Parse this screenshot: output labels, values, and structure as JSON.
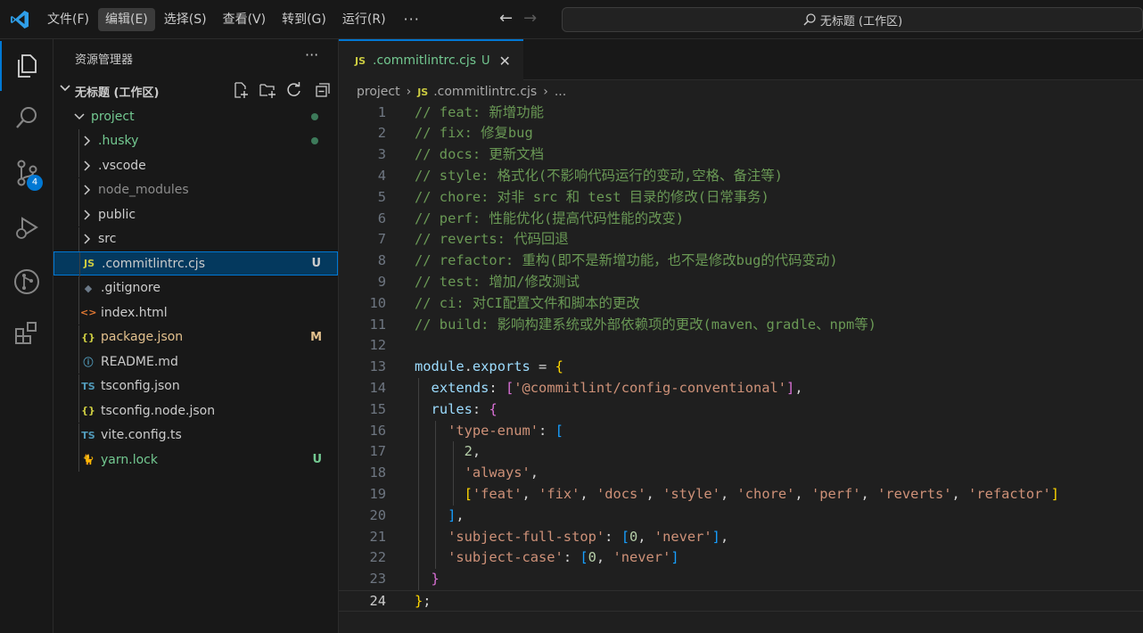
{
  "titlebar": {
    "menu": [
      "文件(F)",
      "编辑(E)",
      "选择(S)",
      "查看(V)",
      "转到(G)",
      "运行(R)",
      "···"
    ],
    "active_menu_index": 1,
    "search_text": "无标题 (工作区)"
  },
  "activity": {
    "items": [
      "explorer-icon",
      "search-icon",
      "source-control-icon",
      "run-debug-icon",
      "git-graph-icon",
      "extensions-icon"
    ],
    "scm_badge": "4"
  },
  "sidebar": {
    "header": "资源管理器",
    "more": "···",
    "workspace_title": "无标题 (工作区)",
    "items": [
      {
        "label": "project",
        "type": "folder-open",
        "color": "#73c991",
        "status": "dot"
      },
      {
        "label": ".husky",
        "type": "folder",
        "color": "#73c991",
        "status": "dot"
      },
      {
        "label": ".vscode",
        "type": "folder",
        "color": "#cccccc",
        "status": ""
      },
      {
        "label": "node_modules",
        "type": "folder",
        "color": "#8c8c8c",
        "status": ""
      },
      {
        "label": "public",
        "type": "folder",
        "color": "#cccccc",
        "status": ""
      },
      {
        "label": "src",
        "type": "folder",
        "color": "#cccccc",
        "status": ""
      },
      {
        "label": ".commitlintrc.cjs",
        "type": "js",
        "icon": "JS",
        "color": "#cccccc",
        "status": "U",
        "status_color": "#cccccc",
        "selected": true
      },
      {
        "label": ".gitignore",
        "type": "gitignore",
        "icon": "◆",
        "color": "#cccccc",
        "status": ""
      },
      {
        "label": "index.html",
        "type": "html",
        "icon": "<>",
        "color": "#cccccc",
        "status": ""
      },
      {
        "label": "package.json",
        "type": "json",
        "icon": "{}",
        "color": "#e2c08d",
        "status": "M",
        "status_color": "#e2c08d"
      },
      {
        "label": "README.md",
        "type": "info",
        "icon": "ⓘ",
        "color": "#cccccc",
        "status": ""
      },
      {
        "label": "tsconfig.json",
        "type": "ts-json",
        "icon": "TS",
        "color": "#cccccc",
        "status": ""
      },
      {
        "label": "tsconfig.node.json",
        "type": "json",
        "icon": "{}",
        "color": "#cccccc",
        "status": ""
      },
      {
        "label": "vite.config.ts",
        "type": "ts",
        "icon": "TS",
        "color": "#cccccc",
        "status": ""
      },
      {
        "label": "yarn.lock",
        "type": "yarn",
        "icon": "🐈",
        "color": "#73c991",
        "status": "U",
        "status_color": "#73c991"
      }
    ]
  },
  "tab": {
    "icon": "JS",
    "label": ".commitlintrc.cjs",
    "status": "U",
    "close": "✕"
  },
  "breadcrumb": {
    "root": "project",
    "file": ".commitlintrc.cjs",
    "ellipsis": "..."
  },
  "editor": {
    "current_line": 24,
    "lines": [
      [
        [
          "c",
          "// feat: 新增功能"
        ]
      ],
      [
        [
          "c",
          "// fix: 修复bug"
        ]
      ],
      [
        [
          "c",
          "// docs: 更新文档"
        ]
      ],
      [
        [
          "c",
          "// style: 格式化(不影响代码运行的变动,空格、备注等)"
        ]
      ],
      [
        [
          "c",
          "// chore: 对非 src 和 test 目录的修改(日常事务)"
        ]
      ],
      [
        [
          "c",
          "// perf: 性能优化(提高代码性能的改变)"
        ]
      ],
      [
        [
          "c",
          "// reverts: 代码回退"
        ]
      ],
      [
        [
          "c",
          "// refactor: 重构(即不是新增功能，也不是修改bug的代码变动)"
        ]
      ],
      [
        [
          "c",
          "// test: 增加/修改测试"
        ]
      ],
      [
        [
          "c",
          "// ci: 对CI配置文件和脚本的更改"
        ]
      ],
      [
        [
          "c",
          "// build: 影响构建系统或外部依赖项的更改(maven、gradle、npm等)"
        ]
      ],
      [],
      [
        [
          "v",
          "module"
        ],
        [
          "p",
          "."
        ],
        [
          "v",
          "exports"
        ],
        [
          "p",
          " = "
        ],
        [
          "b1",
          "{"
        ]
      ],
      [
        [
          "p",
          "  "
        ],
        [
          "v",
          "extends"
        ],
        [
          "p",
          ": "
        ],
        [
          "b2",
          "["
        ],
        [
          "s",
          "'@commitlint/config-conventional'"
        ],
        [
          "b2",
          "]"
        ],
        [
          "p",
          ","
        ]
      ],
      [
        [
          "p",
          "  "
        ],
        [
          "v",
          "rules"
        ],
        [
          "p",
          ": "
        ],
        [
          "b2",
          "{"
        ]
      ],
      [
        [
          "p",
          "    "
        ],
        [
          "s",
          "'type-enum'"
        ],
        [
          "p",
          ": "
        ],
        [
          "b3",
          "["
        ]
      ],
      [
        [
          "p",
          "      "
        ],
        [
          "n",
          "2"
        ],
        [
          "p",
          ","
        ]
      ],
      [
        [
          "p",
          "      "
        ],
        [
          "s",
          "'always'"
        ],
        [
          "p",
          ","
        ]
      ],
      [
        [
          "p",
          "      "
        ],
        [
          "b1",
          "["
        ],
        [
          "s",
          "'feat'"
        ],
        [
          "p",
          ", "
        ],
        [
          "s",
          "'fix'"
        ],
        [
          "p",
          ", "
        ],
        [
          "s",
          "'docs'"
        ],
        [
          "p",
          ", "
        ],
        [
          "s",
          "'style'"
        ],
        [
          "p",
          ", "
        ],
        [
          "s",
          "'chore'"
        ],
        [
          "p",
          ", "
        ],
        [
          "s",
          "'perf'"
        ],
        [
          "p",
          ", "
        ],
        [
          "s",
          "'reverts'"
        ],
        [
          "p",
          ", "
        ],
        [
          "s",
          "'refactor'"
        ],
        [
          "b1",
          "]"
        ]
      ],
      [
        [
          "p",
          "    "
        ],
        [
          "b3",
          "]"
        ],
        [
          "p",
          ","
        ]
      ],
      [
        [
          "p",
          "    "
        ],
        [
          "s",
          "'subject-full-stop'"
        ],
        [
          "p",
          ": "
        ],
        [
          "b3",
          "["
        ],
        [
          "n",
          "0"
        ],
        [
          "p",
          ", "
        ],
        [
          "s",
          "'never'"
        ],
        [
          "b3",
          "]"
        ],
        [
          "p",
          ","
        ]
      ],
      [
        [
          "p",
          "    "
        ],
        [
          "s",
          "'subject-case'"
        ],
        [
          "p",
          ": "
        ],
        [
          "b3",
          "["
        ],
        [
          "n",
          "0"
        ],
        [
          "p",
          ", "
        ],
        [
          "s",
          "'never'"
        ],
        [
          "b3",
          "]"
        ]
      ],
      [
        [
          "p",
          "  "
        ],
        [
          "b2",
          "}"
        ]
      ],
      [
        [
          "b1",
          "}"
        ],
        [
          "p",
          ";"
        ]
      ]
    ]
  }
}
